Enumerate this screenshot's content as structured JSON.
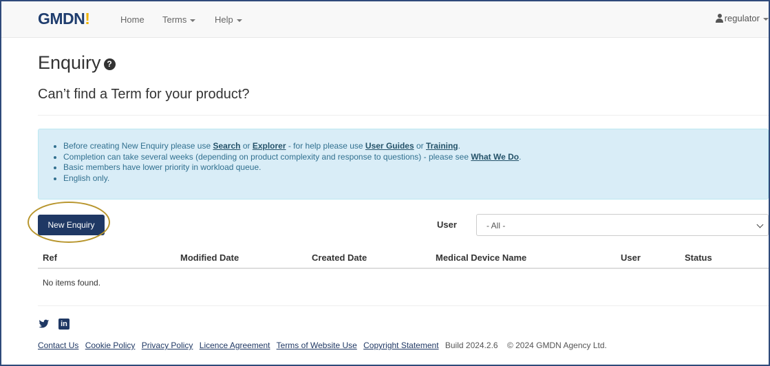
{
  "nav": {
    "logo_main": "GMDN",
    "logo_mark": "!",
    "home": "Home",
    "terms": "Terms",
    "help": "Help",
    "user": "regulator"
  },
  "page": {
    "title": "Enquiry",
    "help_glyph": "?",
    "subtitle": "Can’t find a Term for your product?"
  },
  "alert": {
    "line1_a": "Before creating New Enquiry please use ",
    "line1_search": "Search",
    "line1_or1": " or ",
    "line1_explorer": "Explorer",
    "line1_b": " - for help please use ",
    "line1_guides": "User Guides",
    "line1_or2": " or ",
    "line1_training": "Training",
    "line1_end": ".",
    "line2_a": "Completion can take several weeks (depending on product complexity and response to questions) - please see ",
    "line2_link": "What We Do",
    "line2_end": ".",
    "line3": "Basic members have lower priority in workload queue.",
    "line4": "English only."
  },
  "toolbar": {
    "new_enquiry": "New Enquiry",
    "user_label": "User",
    "user_filter_value": "- All -"
  },
  "table": {
    "columns": [
      "Ref",
      "Modified Date",
      "Created Date",
      "Medical Device Name",
      "User",
      "Status"
    ],
    "empty_text": "No items found."
  },
  "footer": {
    "links": [
      "Contact Us",
      "Cookie Policy",
      "Privacy Policy",
      "Licence Agreement",
      "Terms of Website Use",
      "Copyright Statement"
    ],
    "build": "Build 2024.2.6",
    "copyright": "© 2024 GMDN Agency Ltd.",
    "linkedin_glyph": "in"
  },
  "colors": {
    "brand_navy": "#1f3864",
    "alert_bg": "#d9edf7",
    "highlight_ring": "#b8962e",
    "logo_accent": "#f0b400"
  }
}
